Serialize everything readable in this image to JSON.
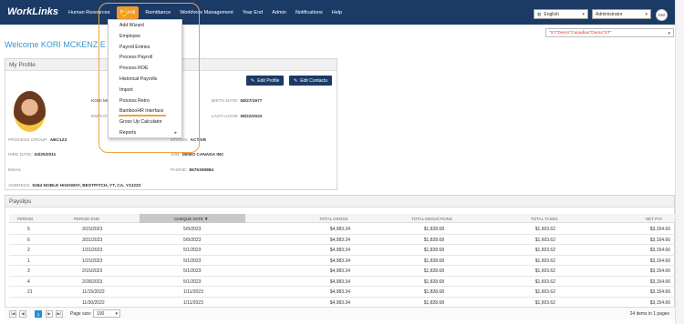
{
  "app": {
    "logo": "WorkLinks"
  },
  "nav": {
    "items": [
      "Human Resources",
      "Payroll",
      "Remittance",
      "Workforce Management",
      "Year End",
      "Admin",
      "Notifications",
      "Help"
    ],
    "language": "English",
    "role": "Administrator",
    "user_initials": "KM"
  },
  "company_select": "\"ST\"Demo\"Canadian\"Demo\"ST\"",
  "welcome": "Welcome KORI MCKENZIE",
  "profile": {
    "title": "My Profile",
    "edit_profile": "Edit Profile",
    "edit_contacts": "Edit Contacts",
    "name_partial": "KORI MC",
    "employee_partial": "EMPLOY",
    "birth_date_label": "BIRTH DATE:",
    "birth_date": "08/27/1977",
    "last_login_label": "LAST LOGIN:",
    "last_login": "08/22/2022",
    "process_group_label": "PROCESS GROUP:",
    "process_group": "ABC123",
    "status_label": "STATUS:",
    "status": "ACTIVE",
    "hire_date_label": "HIRE DATE:",
    "hire_date": "04/25/2011",
    "job_label": "JOB:",
    "job": "DEMO CANADA INC",
    "email_label": "EMAIL",
    "phone_label": "PHONE:",
    "phone": "8675309884",
    "address_label": "ADDRESS:",
    "address": "5264 NOBLE HIGHWAY, BESTPITCH, YT, CA, Y3J2Z2"
  },
  "payroll_menu": {
    "items": [
      "Add Wizard",
      "Employee",
      "Payroll Entries",
      "Process Payroll",
      "Process ROE",
      "Historical Payrolls",
      "Import",
      "Process Retro",
      "BambooHR Interface",
      "Gross Up Calculator",
      "Reports"
    ],
    "submenu_arrow": "▸"
  },
  "payslips": {
    "title": "Payslips",
    "columns": [
      "PERIOD",
      "PERIOD END",
      "CHEQUE DATE",
      "TOTAL GROSS",
      "TOTAL DEDUCTIONS",
      "TOTAL TAXES",
      "NET PAY"
    ],
    "sort_indicator": "▼",
    "rows": [
      [
        "5",
        "3/15/2023",
        "5/9/2023",
        "$4,983.34",
        "$1,828.68",
        "$1,603.62",
        "$3,154.66"
      ],
      [
        "6",
        "3/31/2023",
        "5/9/2023",
        "$4,983.34",
        "$1,828.68",
        "$1,603.62",
        "$3,154.66"
      ],
      [
        "2",
        "1/31/2023",
        "5/1/2023",
        "$4,983.34",
        "$1,828.68",
        "$1,603.62",
        "$3,154.66"
      ],
      [
        "1",
        "1/15/2023",
        "5/1/2023",
        "$4,983.34",
        "$1,828.68",
        "$1,603.62",
        "$3,154.66"
      ],
      [
        "3",
        "2/15/2023",
        "5/1/2023",
        "$4,983.34",
        "$1,828.68",
        "$1,603.62",
        "$3,154.66"
      ],
      [
        "4",
        "2/28/2023",
        "5/1/2023",
        "$4,983.34",
        "$1,828.68",
        "$1,603.62",
        "$3,154.66"
      ],
      [
        "21",
        "11/15/2022",
        "1/11/2023",
        "$4,983.34",
        "$1,828.68",
        "$1,603.62",
        "$3,154.66"
      ],
      [
        "",
        "11/30/2022",
        "1/11/2023",
        "$4,983.34",
        "$1,828.68",
        "$1,603.62",
        "$3,154.66"
      ]
    ],
    "pager": {
      "first": "|◀",
      "prev": "◀",
      "current": "1",
      "next": "▶",
      "last": "▶|",
      "page_size_label": "Page size:",
      "page_size": "100",
      "summary": "24 items in 1 pages"
    }
  },
  "colors": {
    "nav_bg": "#1b3a66",
    "accent": "#f29a2e",
    "link": "#3b95c8"
  }
}
